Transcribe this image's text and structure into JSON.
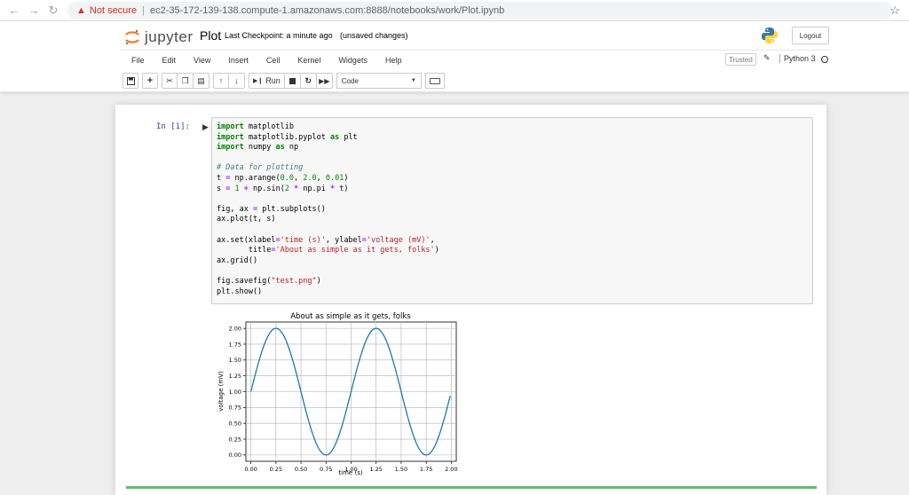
{
  "browser": {
    "security_label": "Not secure",
    "url": "ec2-35-172-139-138.compute-1.amazonaws.com:8888/notebooks/work/Plot.ipynb"
  },
  "header": {
    "logo_text": "jupyter",
    "notebook_name": "Plot",
    "checkpoint": "Last Checkpoint: a minute ago",
    "unsaved": "(unsaved changes)",
    "logout": "Logout",
    "trusted": "Trusted",
    "kernel": "Python 3"
  },
  "menu": [
    "File",
    "Edit",
    "View",
    "Insert",
    "Cell",
    "Kernel",
    "Widgets",
    "Help"
  ],
  "toolbar": {
    "run_label": "Run",
    "cell_type": "Code"
  },
  "cell": {
    "prompt": "In [1]:"
  },
  "colors": {
    "line": "#1f77b4",
    "prompt": "#303f9f",
    "keyword": "#008000",
    "string": "#ba2121"
  },
  "chart_data": {
    "type": "line",
    "title": "About as simple as it gets, folks",
    "xlabel": "time (s)",
    "ylabel": "voltage (mV)",
    "xlim": [
      -0.05,
      2.05
    ],
    "ylim": [
      -0.1,
      2.1
    ],
    "xticks": [
      "0.00",
      "0.25",
      "0.50",
      "0.75",
      "1.00",
      "1.25",
      "1.50",
      "1.75",
      "2.00"
    ],
    "yticks": [
      "0.00",
      "0.25",
      "0.50",
      "0.75",
      "1.00",
      "1.25",
      "1.50",
      "1.75",
      "2.00"
    ],
    "grid": true,
    "series": [
      {
        "formula": "s = 1 + sin(2*pi*t)",
        "x": [
          0.0,
          0.125,
          0.25,
          0.375,
          0.5,
          0.625,
          0.75,
          0.875,
          1.0,
          1.125,
          1.25,
          1.375,
          1.5,
          1.625,
          1.75,
          1.875,
          1.99
        ],
        "y": [
          1.0,
          1.71,
          2.0,
          1.71,
          1.0,
          0.29,
          0.0,
          0.29,
          1.0,
          1.71,
          2.0,
          1.71,
          1.0,
          0.29,
          0.0,
          0.29,
          0.94
        ]
      }
    ]
  }
}
